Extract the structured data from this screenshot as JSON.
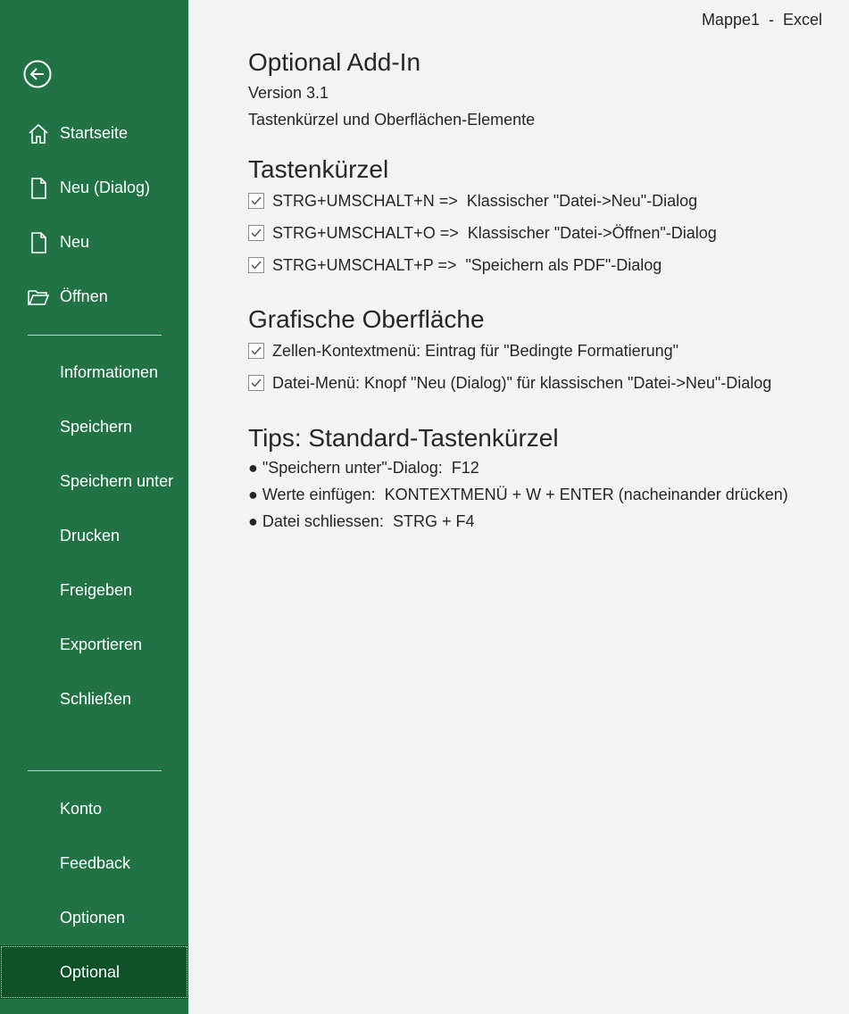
{
  "window": {
    "title": "Mappe1  -  Excel"
  },
  "sidebar": {
    "back_icon": "back-arrow-icon",
    "top_items": [
      {
        "label": "Startseite",
        "icon": "home-icon"
      },
      {
        "label": "Neu (Dialog)",
        "icon": "new-document-icon"
      },
      {
        "label": "Neu",
        "icon": "new-document-icon"
      },
      {
        "label": "Öffnen",
        "icon": "open-folder-icon"
      }
    ],
    "middle_items": [
      {
        "label": "Informationen"
      },
      {
        "label": "Speichern"
      },
      {
        "label": "Speichern unter"
      },
      {
        "label": "Drucken"
      },
      {
        "label": "Freigeben"
      },
      {
        "label": "Exportieren"
      },
      {
        "label": "Schließen"
      }
    ],
    "bottom_items": [
      {
        "label": "Konto"
      },
      {
        "label": "Feedback"
      },
      {
        "label": "Optionen"
      },
      {
        "label": "Optional",
        "selected": true
      }
    ],
    "colors": {
      "background": "#217346",
      "selected": "#0e5128"
    }
  },
  "main": {
    "title": "Optional Add-In",
    "version": "Version 3.1",
    "description": "Tastenkürzel und Oberflächen-Elemente",
    "shortcuts_section": {
      "heading": "Tastenkürzel",
      "items": [
        {
          "label": "STRG+UMSCHALT+N =>  Klassischer \"Datei->Neu\"-Dialog",
          "checked": true
        },
        {
          "label": "STRG+UMSCHALT+O =>  Klassischer \"Datei->Öffnen\"-Dialog",
          "checked": true
        },
        {
          "label": "STRG+UMSCHALT+P =>  \"Speichern als PDF\"-Dialog",
          "checked": true
        }
      ]
    },
    "ui_section": {
      "heading": "Grafische Oberfläche",
      "items": [
        {
          "label": "Zellen-Kontextmenü: Eintrag für \"Bedingte Formatierung\"",
          "checked": true
        },
        {
          "label": "Datei-Menü: Knopf \"Neu (Dialog)\" für klassischen \"Datei->Neu\"-Dialog",
          "checked": true
        }
      ]
    },
    "tips_section": {
      "heading": "Tips: Standard-Tastenkürzel",
      "items": [
        "● \"Speichern unter\"-Dialog:  F12",
        "● Werte einfügen:  KONTEXTMENÜ + W + ENTER (nacheinander drücken)",
        "● Datei schliessen:  STRG + F4"
      ]
    }
  }
}
